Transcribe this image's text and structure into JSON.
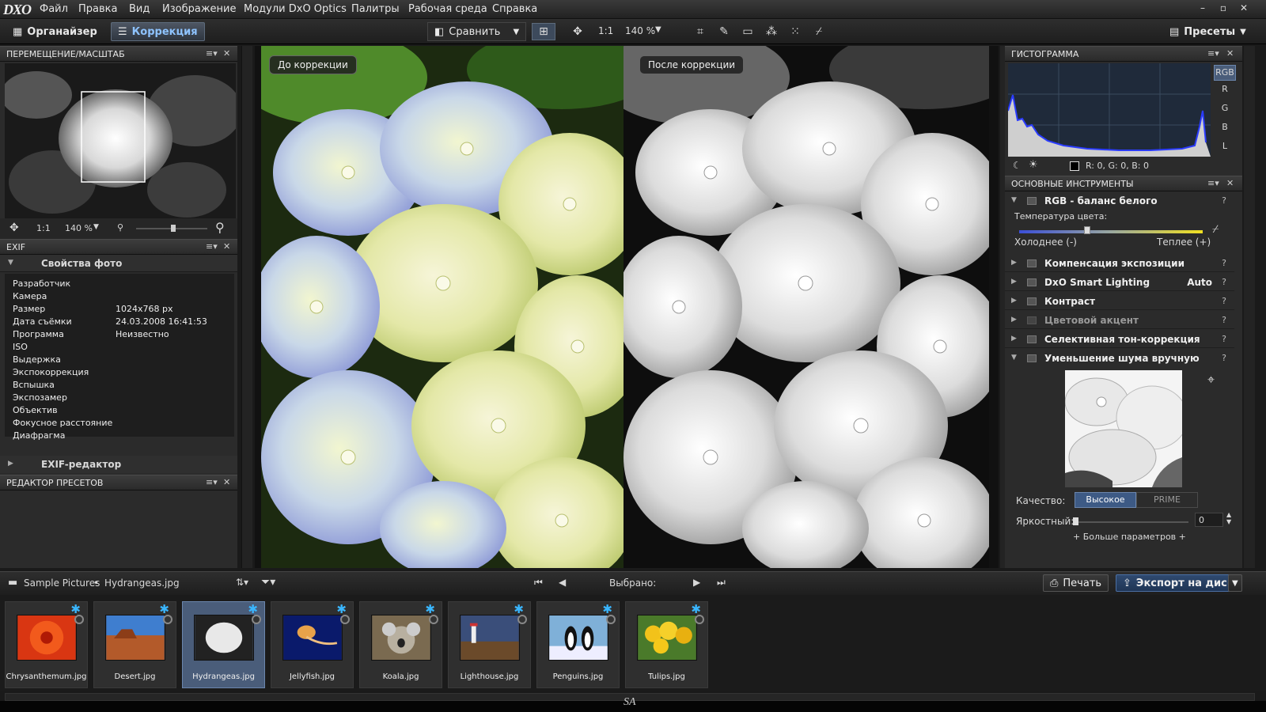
{
  "app": {
    "logo": "DXO"
  },
  "menu": [
    "Файл",
    "Правка",
    "Вид",
    "Изображение",
    "Модули DxO Optics",
    "Палитры",
    "Рабочая среда",
    "Справка"
  ],
  "window_controls": [
    "–",
    "▫",
    "✕"
  ],
  "toolbar": {
    "organizer": "Органайзер",
    "correction": "Коррекция",
    "compare": "Сравнить",
    "zoom_1to1": "1:1",
    "zoom_level": "140 %",
    "presets": "Пресеты"
  },
  "navigator": {
    "title": "ПЕРЕМЕЩЕНИЕ/МАСШТАБ",
    "zoom_1to1": "1:1",
    "zoom_level": "140 %"
  },
  "exif": {
    "title": "EXIF",
    "section": "Свойства фото",
    "rows": [
      {
        "k": "Разработчик",
        "v": ""
      },
      {
        "k": "Камера",
        "v": ""
      },
      {
        "k": "Размер",
        "v": "1024x768 px"
      },
      {
        "k": "Дата съёмки",
        "v": "24.03.2008 16:41:53"
      },
      {
        "k": "Программа",
        "v": "Неизвестно"
      },
      {
        "k": "ISO",
        "v": ""
      },
      {
        "k": "Выдержка",
        "v": ""
      },
      {
        "k": "Экспокоррекция",
        "v": ""
      },
      {
        "k": "Вспышка",
        "v": ""
      },
      {
        "k": "Экспозамер",
        "v": ""
      },
      {
        "k": "Объектив",
        "v": ""
      },
      {
        "k": "Фокусное расстояние",
        "v": ""
      },
      {
        "k": "Диафрагма",
        "v": ""
      }
    ],
    "exif_editor": "EXIF-редактор"
  },
  "preset_editor": {
    "title": "РЕДАКТОР ПРЕСЕТОВ"
  },
  "viewer": {
    "before": "До коррекции",
    "after": "После коррекции"
  },
  "histogram": {
    "title": "ГИСТОГРАММА",
    "channels": [
      "RGB",
      "R",
      "G",
      "B",
      "L"
    ],
    "readout": "R:  0, G:   0, B:   0"
  },
  "tools": {
    "title": "ОСНОВНЫЕ ИНСТРУМЕНТЫ",
    "white_balance": "RGB - баланс белого",
    "temp_label": "Температура цвета:",
    "cold": "Холоднее (-)",
    "warm": "Теплее (+)",
    "temp_position": 0.37,
    "items": [
      {
        "label": "Компенсация экспозиции",
        "extra": ""
      },
      {
        "label": "DxO Smart Lighting",
        "extra": "Auto"
      },
      {
        "label": "Контраст",
        "extra": ""
      },
      {
        "label": "Цветовой акцент",
        "extra": ""
      },
      {
        "label": "Селективная тон-коррекция",
        "extra": ""
      }
    ],
    "noise": "Уменьшение шума вручную",
    "quality_label": "Качество:",
    "quality_high": "Высокое",
    "quality_prime": "PRIME",
    "brightness_label": "Яркостный:",
    "brightness_value": "0",
    "more": "+ Больше параметров +",
    "help": "?"
  },
  "filmstrip": {
    "path_root": "Sample Pictures",
    "path_file": "Hydrangeas.jpg",
    "selected": "Выбрано:",
    "print": "Печать",
    "export": "Экспорт на диск",
    "items": [
      "Chrysanthemum.jpg",
      "Desert.jpg",
      "Hydrangeas.jpg",
      "Jellyfish.jpg",
      "Koala.jpg",
      "Lighthouse.jpg",
      "Penguins.jpg",
      "Tulips.jpg"
    ]
  },
  "watermark": "SA"
}
